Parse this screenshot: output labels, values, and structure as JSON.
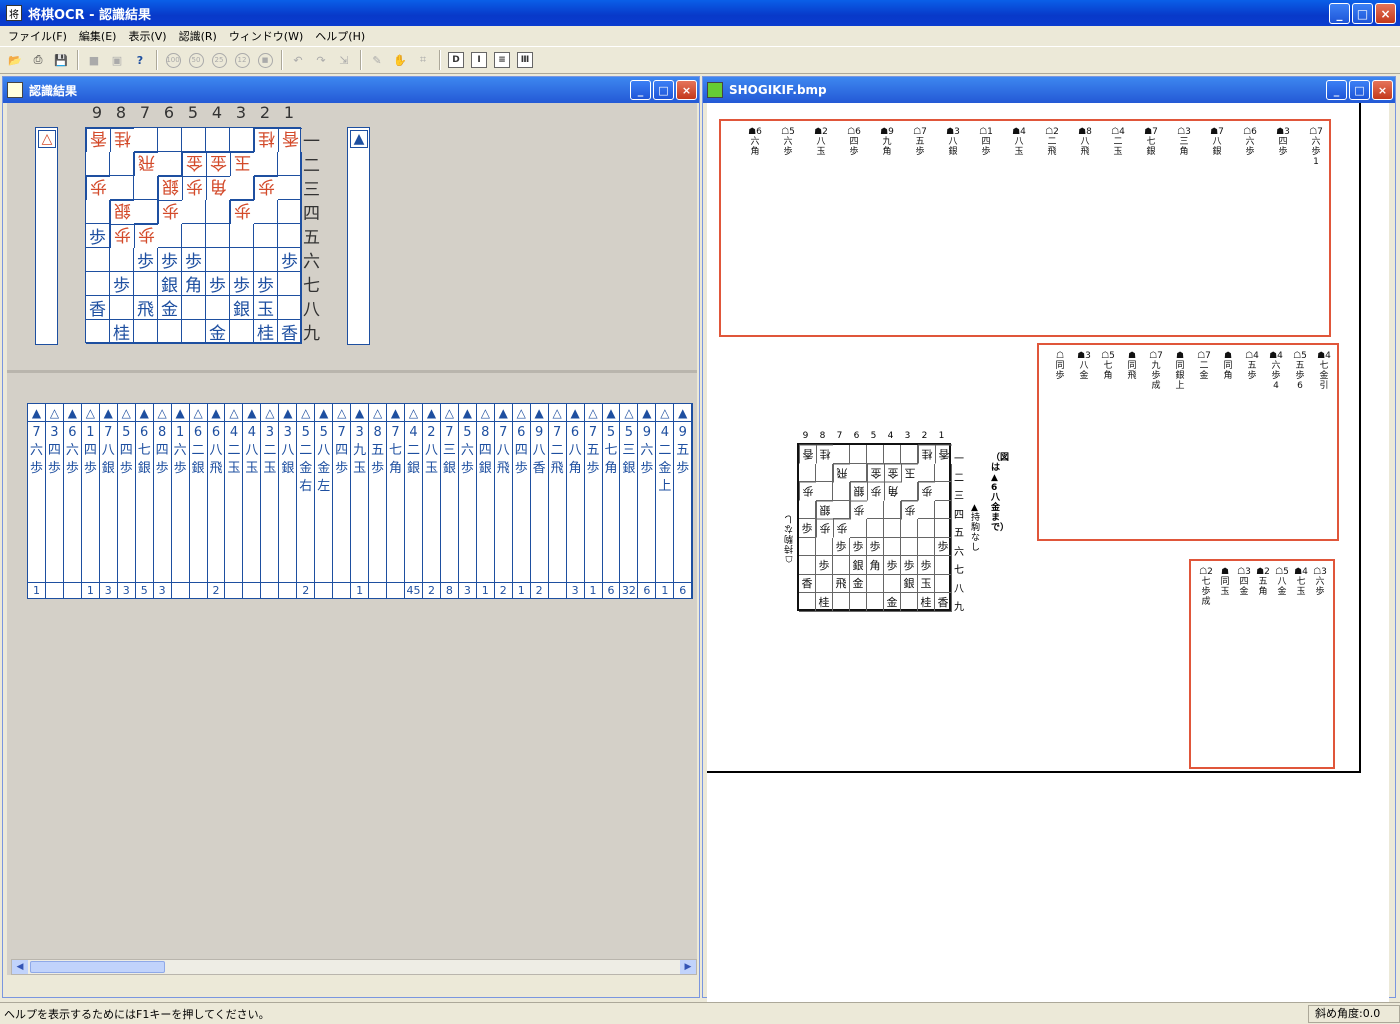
{
  "app": {
    "title": "将棋OCR - 認識結果",
    "icon": "shogi-app-icon"
  },
  "window_buttons": {
    "minimize": "_",
    "maximize": "□",
    "close": "×"
  },
  "menu": [
    "ファイル(F)",
    "編集(E)",
    "表示(V)",
    "認識(R)",
    "ウィンドウ(W)",
    "ヘルプ(H)"
  ],
  "toolbar": {
    "icons": [
      "open-folder-icon",
      "print-icon",
      "save-icon",
      "stop-icon",
      "frame-icon",
      "help-icon",
      "circle-100-icon",
      "circle-50-icon",
      "circle-25-icon",
      "circle-12-icon",
      "circle-stop-icon",
      "rotate-left-icon",
      "rotate-right-icon",
      "export-icon",
      "pencil-icon",
      "hand-icon",
      "crop-icon",
      "d-icon",
      "i-icon",
      "list-icon",
      "columns-icon"
    ],
    "circle_labels": [
      "100",
      "50",
      "25",
      "12"
    ],
    "box_labels": [
      "D",
      "I",
      "≡",
      "Ⅲ"
    ],
    "help_label": "?"
  },
  "left_window": {
    "title": "認識結果",
    "sente_hand_mark": "▲",
    "gote_hand_mark": "△",
    "file_labels": [
      "9",
      "8",
      "7",
      "6",
      "5",
      "4",
      "3",
      "2",
      "1"
    ],
    "rank_labels": [
      "一",
      "二",
      "三",
      "四",
      "五",
      "六",
      "七",
      "八",
      "九"
    ],
    "board": [
      [
        "g:香",
        "g:桂",
        "",
        "",
        "",
        "",
        "",
        "g:桂",
        "g:香"
      ],
      [
        "",
        "",
        "g:飛",
        "",
        "g:金",
        "g:金",
        "g:玉",
        "",
        ""
      ],
      [
        "g:歩",
        "",
        "",
        "g:銀",
        "g:歩",
        "g:角",
        "",
        "g:歩",
        ""
      ],
      [
        "",
        "g:銀",
        "",
        "g:歩",
        "",
        "",
        "g:歩",
        "",
        ""
      ],
      [
        "歩",
        "g:歩",
        "g:歩",
        "",
        "",
        "",
        "",
        "",
        ""
      ],
      [
        "",
        "",
        "歩",
        "歩",
        "歩",
        "",
        "",
        "",
        "歩"
      ],
      [
        "",
        "歩",
        "",
        "銀",
        "角",
        "歩",
        "歩",
        "歩",
        ""
      ],
      [
        "香",
        "",
        "飛",
        "金",
        "",
        "",
        "銀",
        "玉",
        ""
      ],
      [
        "",
        "桂",
        "",
        "",
        "",
        "金",
        "",
        "桂",
        "香"
      ]
    ],
    "moves": [
      {
        "mark": "▲",
        "text": "7六歩",
        "count": "1"
      },
      {
        "mark": "△",
        "text": "3四歩",
        "count": ""
      },
      {
        "mark": "▲",
        "text": "6六歩",
        "count": ""
      },
      {
        "mark": "△",
        "text": "1四歩",
        "count": "1"
      },
      {
        "mark": "▲",
        "text": "7八銀",
        "count": "3"
      },
      {
        "mark": "△",
        "text": "5四歩",
        "count": "3"
      },
      {
        "mark": "▲",
        "text": "6七銀",
        "count": "5"
      },
      {
        "mark": "△",
        "text": "8四歩",
        "count": "3"
      },
      {
        "mark": "▲",
        "text": "1六歩",
        "count": ""
      },
      {
        "mark": "△",
        "text": "6二銀",
        "count": ""
      },
      {
        "mark": "▲",
        "text": "6八飛",
        "count": "2"
      },
      {
        "mark": "△",
        "text": "4二玉",
        "count": ""
      },
      {
        "mark": "▲",
        "text": "4八玉",
        "count": ""
      },
      {
        "mark": "△",
        "text": "3二玉",
        "count": ""
      },
      {
        "mark": "▲",
        "text": "3八銀",
        "count": ""
      },
      {
        "mark": "△",
        "text": "5二金右",
        "count": "2"
      },
      {
        "mark": "▲",
        "text": "5八金左",
        "count": ""
      },
      {
        "mark": "△",
        "text": "7四歩",
        "count": ""
      },
      {
        "mark": "▲",
        "text": "3九玉",
        "count": "1"
      },
      {
        "mark": "△",
        "text": "8五歩",
        "count": ""
      },
      {
        "mark": "▲",
        "text": "7七角",
        "count": ""
      },
      {
        "mark": "△",
        "text": "4二銀",
        "count": "45"
      },
      {
        "mark": "▲",
        "text": "2八玉",
        "count": "2"
      },
      {
        "mark": "△",
        "text": "7三銀",
        "count": "8"
      },
      {
        "mark": "▲",
        "text": "5六歩",
        "count": "3"
      },
      {
        "mark": "△",
        "text": "8四銀",
        "count": "1"
      },
      {
        "mark": "▲",
        "text": "7八飛",
        "count": "2"
      },
      {
        "mark": "△",
        "text": "6四歩",
        "count": "1"
      },
      {
        "mark": "▲",
        "text": "9八香",
        "count": "2"
      },
      {
        "mark": "△",
        "text": "7二飛",
        "count": ""
      },
      {
        "mark": "▲",
        "text": "6八角",
        "count": "3"
      },
      {
        "mark": "△",
        "text": "7五歩",
        "count": "1"
      },
      {
        "mark": "▲",
        "text": "5七角",
        "count": "6"
      },
      {
        "mark": "△",
        "text": "5三銀",
        "count": "32"
      },
      {
        "mark": "▲",
        "text": "9六歩",
        "count": "6"
      },
      {
        "mark": "△",
        "text": "4二金上",
        "count": "1"
      },
      {
        "mark": "▲",
        "text": "9五歩",
        "count": "6"
      }
    ]
  },
  "right_window": {
    "title": "SHOGIKIF.bmp",
    "doc_columns": [
      "☖7六歩1",
      "☗3四歩",
      "☖6六歩",
      "☗7八銀",
      "☖3三角",
      "☗7七銀",
      "☖4二玉",
      "☗8八飛",
      "☖2二飛",
      "☗4八玉",
      "☖1四歩",
      "☗3八銀",
      "☖7五歩",
      "☗9九角",
      "☖6四歩",
      "☗2八玉",
      "☖5六歩",
      "☗6六角"
    ],
    "doc_columns_mid": [
      "☗4七金引",
      "☖5五歩6",
      "☗4六歩4",
      "☖4五歩",
      "☗同角",
      "☖7二金",
      "☗同銀上",
      "☖7九歩成",
      "☗同飛",
      "☖5七角",
      "☗3八金",
      "☖同歩"
    ],
    "doc_columns_low": [
      "☖3六歩",
      "☗4七玉",
      "☖5八金",
      "☗2五角",
      "☖3四金",
      "☗同玉",
      "☖2七歩成"
    ],
    "scan_files": [
      "9",
      "8",
      "7",
      "6",
      "5",
      "4",
      "3",
      "2",
      "1"
    ],
    "scan_ranks": [
      "一",
      "二",
      "三",
      "四",
      "五",
      "六",
      "七",
      "八",
      "九"
    ],
    "scan_caption": "（図は▲6八金まで）",
    "scan_side_labels": [
      "▲持駒 なし",
      "☖持駒 なし"
    ]
  },
  "status": {
    "help": "ヘルプを表示するためにはF1キーを押してください。",
    "angle": "斜め角度:0.0"
  }
}
